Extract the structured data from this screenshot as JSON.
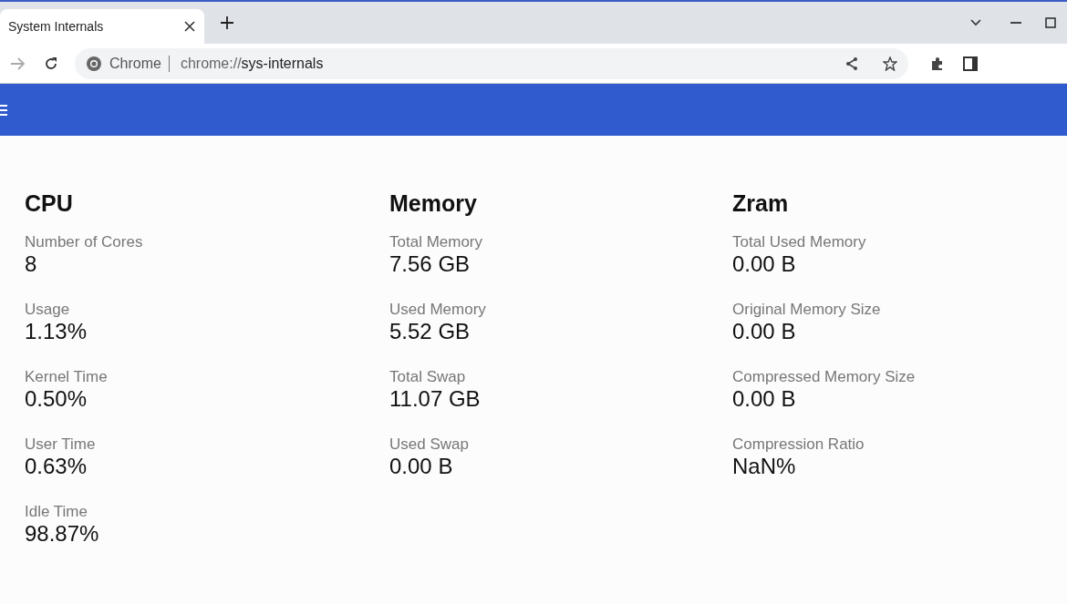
{
  "browser": {
    "tab": {
      "title": "System Internals",
      "selected": true
    },
    "site_chip": "Chrome",
    "url_scheme": "chrome://",
    "url_path": "sys-internals"
  },
  "sections": [
    {
      "title": "CPU",
      "items": [
        {
          "label": "Number of Cores",
          "value": "8"
        },
        {
          "label": "Usage",
          "value": "1.13%"
        },
        {
          "label": "Kernel Time",
          "value": "0.50%"
        },
        {
          "label": "User Time",
          "value": "0.63%"
        },
        {
          "label": "Idle Time",
          "value": "98.87%"
        }
      ]
    },
    {
      "title": "Memory",
      "items": [
        {
          "label": "Total Memory",
          "value": "7.56 GB"
        },
        {
          "label": "Used Memory",
          "value": "5.52 GB"
        },
        {
          "label": "Total Swap",
          "value": "11.07 GB"
        },
        {
          "label": "Used Swap",
          "value": "0.00 B"
        }
      ]
    },
    {
      "title": "Zram",
      "items": [
        {
          "label": "Total Used Memory",
          "value": "0.00 B"
        },
        {
          "label": "Original Memory Size",
          "value": "0.00 B"
        },
        {
          "label": "Compressed Memory Size",
          "value": "0.00 B"
        },
        {
          "label": "Compression Ratio",
          "value": "NaN%"
        }
      ]
    }
  ]
}
